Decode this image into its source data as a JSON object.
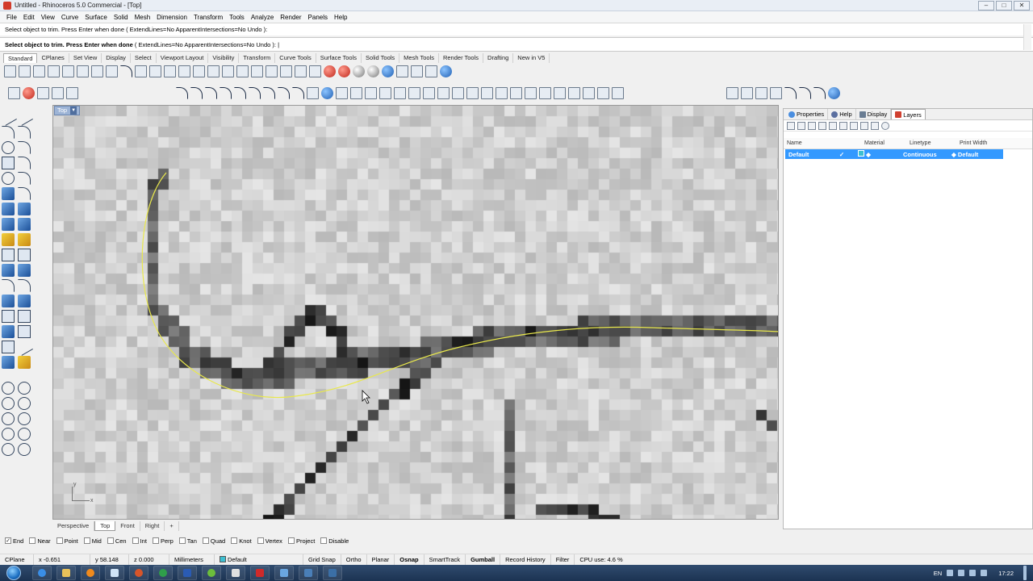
{
  "window": {
    "title": "Untitled - Rhinoceros 5.0 Commercial - [Top]",
    "controls": [
      "–",
      "□",
      "✕"
    ]
  },
  "menubar": [
    "File",
    "Edit",
    "View",
    "Curve",
    "Surface",
    "Solid",
    "Mesh",
    "Dimension",
    "Transform",
    "Tools",
    "Analyze",
    "Render",
    "Panels",
    "Help"
  ],
  "command": {
    "history": "Select object to trim. Press Enter when done ( ExtendLines=No  ApparentIntersections=No  Undo ):",
    "prompt_label": "Select object to trim. Press Enter when done",
    "prompt_options": " ( ExtendLines=No  ApparentIntersections=No  Undo ): |"
  },
  "toolbar_tabs": [
    "Standard",
    "CPlanes",
    "Set View",
    "Display",
    "Select",
    "Viewport Layout",
    "Visibility",
    "Transform",
    "Curve Tools",
    "Surface Tools",
    "Solid Tools",
    "Mesh Tools",
    "Render Tools",
    "Drafting",
    "New in V5"
  ],
  "viewport": {
    "name": "Top",
    "axis_y": "y",
    "axis_x": "x",
    "curve_color": "#e9e84c",
    "tabs": [
      "Perspective",
      "Top",
      "Front",
      "Right",
      "+"
    ],
    "active_tab": "Top"
  },
  "panel": {
    "tabs": [
      "Properties",
      "Help",
      "Display",
      "Layers"
    ],
    "active_tab": "Layers",
    "columns": [
      "Name",
      "Material",
      "Linetype",
      "Print Width"
    ],
    "layer": {
      "name": "Default",
      "check": "✓",
      "linetype": "Continuous",
      "print_width": "Default",
      "color": "#3dbfd1"
    }
  },
  "osnap": [
    {
      "label": "End",
      "checked": true
    },
    {
      "label": "Near",
      "checked": false
    },
    {
      "label": "Point",
      "checked": false
    },
    {
      "label": "Mid",
      "checked": false
    },
    {
      "label": "Cen",
      "checked": false
    },
    {
      "label": "Int",
      "checked": false
    },
    {
      "label": "Perp",
      "checked": false
    },
    {
      "label": "Tan",
      "checked": false
    },
    {
      "label": "Quad",
      "checked": false
    },
    {
      "label": "Knot",
      "checked": false
    },
    {
      "label": "Vertex",
      "checked": false
    },
    {
      "label": "Project",
      "checked": false
    },
    {
      "label": "Disable",
      "checked": false
    }
  ],
  "status": {
    "cplane": "CPlane",
    "x": "x -0.651",
    "y": "y 58.148",
    "z": "z 0.000",
    "units": "Millimeters",
    "layer": "Default",
    "grid_snap": "Grid Snap",
    "ortho": "Ortho",
    "planar": "Planar",
    "osnap": "Osnap",
    "smarttrack": "SmartTrack",
    "gumball": "Gumball",
    "record_history": "Record History",
    "filter": "Filter",
    "cpu": "CPU use: 4.6 %"
  },
  "taskbar": {
    "language": "EN",
    "time": "17:22"
  }
}
